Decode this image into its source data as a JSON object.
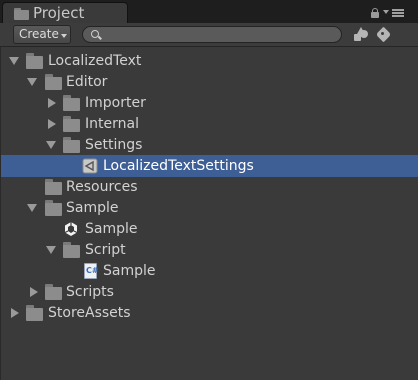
{
  "panel": {
    "tab_title": "Project",
    "create_label": "Create",
    "search_placeholder": "",
    "icons": [
      "folder-icon",
      "lock-icon",
      "panel-menu-icon",
      "search-icon",
      "filter-by-type-icon",
      "filter-by-label-icon"
    ]
  },
  "colors": {
    "selection": "#3e5e96",
    "panel_bg": "#3a3a3a",
    "text": "#d2d2d2"
  },
  "tree": {
    "items": [
      {
        "label": "LocalizedText",
        "depth": 0,
        "expanded": true,
        "icon": "folder-icon"
      },
      {
        "label": "Editor",
        "depth": 1,
        "expanded": true,
        "icon": "folder-icon"
      },
      {
        "label": "Importer",
        "depth": 2,
        "expanded": false,
        "icon": "folder-icon"
      },
      {
        "label": "Internal",
        "depth": 2,
        "expanded": false,
        "icon": "folder-icon"
      },
      {
        "label": "Settings",
        "depth": 2,
        "expanded": true,
        "icon": "folder-icon"
      },
      {
        "label": "LocalizedTextSettings",
        "depth": 3,
        "selected": true,
        "icon": "scriptable-object-icon"
      },
      {
        "label": "Resources",
        "depth": 1,
        "icon": "folder-icon"
      },
      {
        "label": "Sample",
        "depth": 1,
        "expanded": true,
        "icon": "folder-icon"
      },
      {
        "label": "Sample",
        "depth": 2,
        "icon": "unity-scene-icon"
      },
      {
        "label": "Script",
        "depth": 2,
        "expanded": true,
        "icon": "folder-icon"
      },
      {
        "label": "Sample",
        "depth": 3,
        "icon": "csharp-script-icon"
      },
      {
        "label": "Scripts",
        "depth": 1,
        "expanded": false,
        "icon": "folder-icon"
      },
      {
        "label": "StoreAssets",
        "depth": 0,
        "expanded": false,
        "icon": "folder-icon"
      }
    ]
  }
}
